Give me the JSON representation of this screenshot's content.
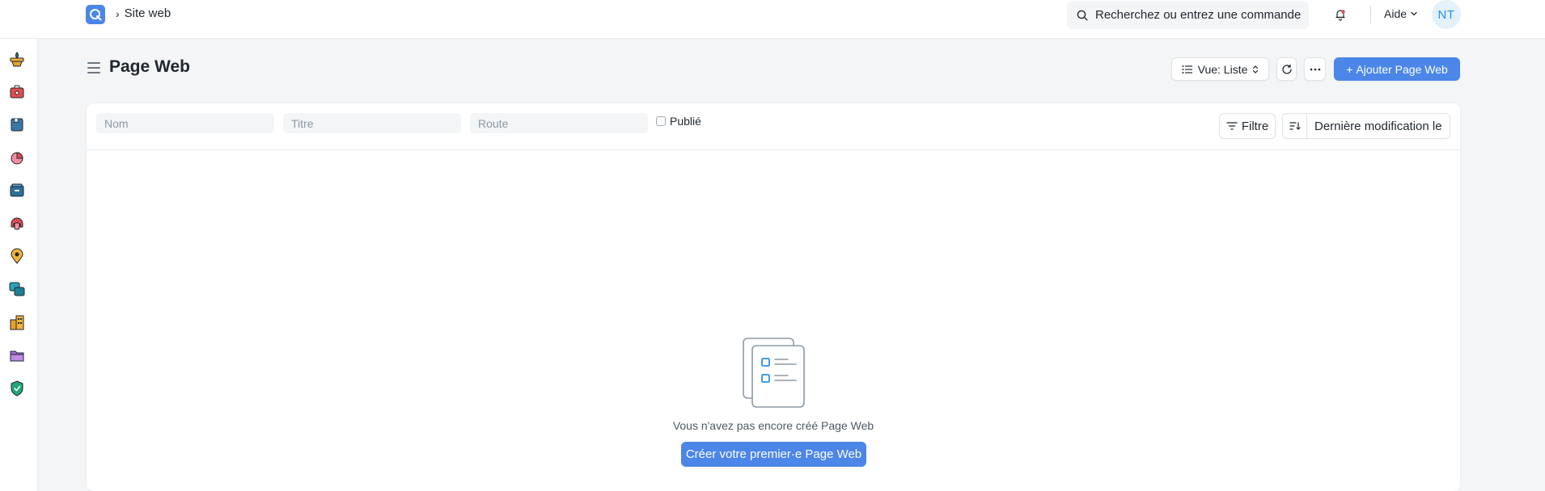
{
  "navbar": {
    "breadcrumb": "Site web",
    "search_placeholder": "Recherchez ou entrez une commande",
    "help_label": "Aide",
    "avatar_initials": "NT"
  },
  "sidebar": {
    "icons": [
      "plant-pot-icon",
      "toolbox-icon",
      "book-icon",
      "pie-chart-icon",
      "archive-box-icon",
      "support-icon",
      "map-pin-icon",
      "chat-bubbles-icon",
      "building-icon",
      "folder-icon",
      "shield-icon"
    ]
  },
  "page": {
    "title": "Page Web",
    "view_label": "Vue: Liste",
    "add_label": "Ajouter Page Web"
  },
  "filters": {
    "name_placeholder": "Nom",
    "title_placeholder": "Titre",
    "route_placeholder": "Route",
    "published_label": "Publié",
    "filter_label": "Filtre",
    "sort_label": "Dernière modification le"
  },
  "empty_state": {
    "message": "Vous n'avez pas encore créé Page Web",
    "create_label": "Créer votre premier·e Page Web"
  },
  "colors": {
    "primary": "#4b86e8",
    "background": "#f3f5f7"
  }
}
